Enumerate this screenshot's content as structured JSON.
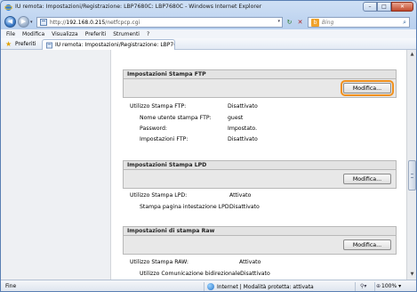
{
  "window": {
    "title": "IU remota: Impostazioni/Registrazione: LBP7680C: LBP7680C - Windows Internet Explorer",
    "min": "–",
    "max": "□",
    "close": "✕"
  },
  "address": {
    "url_prefix": "http://",
    "url_host": "192.168.0.215",
    "url_path": "/netfcpcp.cgi",
    "search_placeholder": "Bing"
  },
  "menu": [
    "File",
    "Modifica",
    "Visualizza",
    "Preferiti",
    "Strumenti",
    "?"
  ],
  "favorites": {
    "label": "Preferiti",
    "tab_title": "IU remota: Impostazioni/Registrazione: LBP7680C..."
  },
  "sections": {
    "ftp": {
      "title": "Impostazioni Stampa FTP",
      "button": "Modifica...",
      "rows": [
        {
          "label": "Utilizzo Stampa FTP:",
          "value": "Disattivato"
        },
        {
          "label": "Nome utente stampa FTP:",
          "value": "guest"
        },
        {
          "label": "Password:",
          "value": "Impostato."
        },
        {
          "label": "Impostazioni FTP:",
          "value": "Disattivato"
        }
      ]
    },
    "lpd": {
      "title": "Impostazioni Stampa LPD",
      "button": "Modifica...",
      "rows": [
        {
          "label": "Utilizzo Stampa LPD:",
          "value": "Attivato"
        },
        {
          "label": "Stampa pagina intestazione LPD:",
          "value": "Disattivato"
        }
      ]
    },
    "raw": {
      "title": "Impostazioni di stampa Raw",
      "button": "Modifica...",
      "rows": [
        {
          "label": "Utilizzo Stampa RAW:",
          "value": "Attivato"
        },
        {
          "label": "Utilizzo Comunicazione bidirezionale:",
          "value": "Disattivato"
        }
      ]
    }
  },
  "status": {
    "left": "Fine",
    "zone": "Internet | Modalità protetta: attivata",
    "zoom": "100%"
  },
  "colors": {
    "highlight": "#f0901c",
    "section_header": "#e3e3e3"
  }
}
